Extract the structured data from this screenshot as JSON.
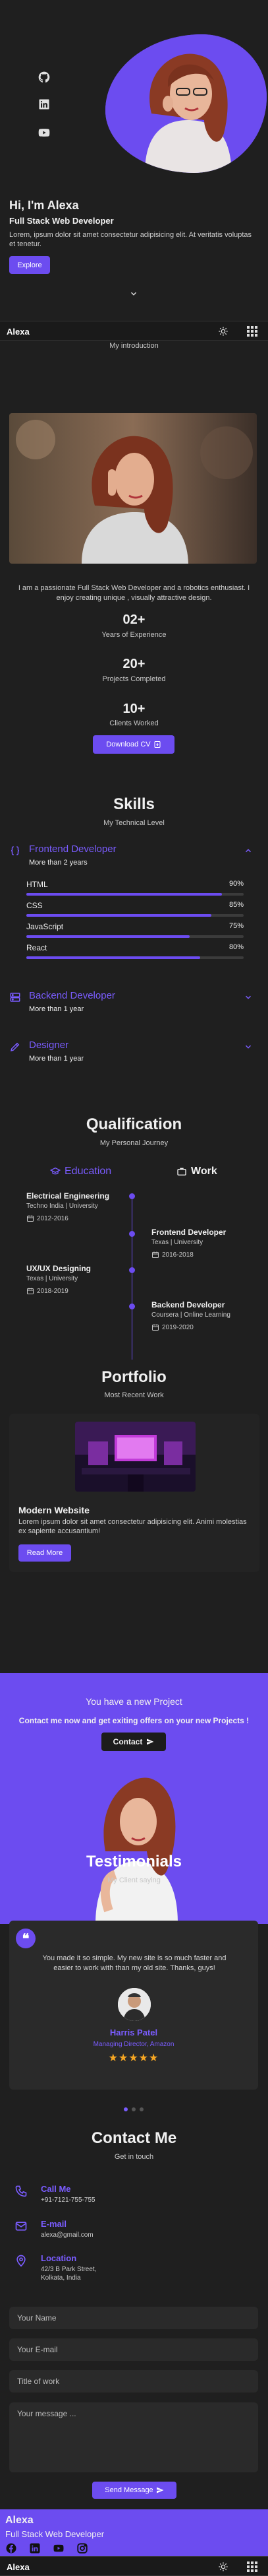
{
  "hero": {
    "title": "Hi, I'm Alexa",
    "subtitle": "Full Stack Web Developer",
    "description": "Lorem, ipsum dolor sit amet consectetur adipisicing elit. At veritatis voluptas et tenetur.",
    "button": "Explore",
    "social_icons": [
      "github-icon",
      "linkedin-icon",
      "youtube-icon"
    ]
  },
  "header": {
    "logo": "Alexa"
  },
  "about": {
    "section_subtitle": "My introduction",
    "description": "I am a passionate Full Stack Web Developer and a robotics enthusiast. I enjoy creating unique , visually attractive design.",
    "stats": [
      {
        "num": "02+",
        "label": "Years of Experience"
      },
      {
        "num": "20+",
        "label": "Projects Completed"
      },
      {
        "num": "10+",
        "label": "Clients Worked"
      }
    ],
    "download": "Download CV"
  },
  "skills": {
    "title": "Skills",
    "subtitle": "My Technical Level",
    "groups": [
      {
        "title": "Frontend Developer",
        "sub": "More than 2 years",
        "items": [
          {
            "name": "HTML",
            "pct": "90%",
            "value": 0.9
          },
          {
            "name": "CSS",
            "pct": "85%",
            "value": 0.85
          },
          {
            "name": "JavaScript",
            "pct": "75%",
            "value": 0.75
          },
          {
            "name": "React",
            "pct": "80%",
            "value": 0.8
          }
        ]
      },
      {
        "title": "Backend Developer",
        "sub": "More than 1 year"
      },
      {
        "title": "Designer",
        "sub": "More than 1 year"
      }
    ]
  },
  "qualification": {
    "title": "Qualification",
    "subtitle": "My Personal Journey",
    "tabs": [
      "Education",
      "Work"
    ],
    "items": [
      {
        "title": "Electrical Engineering",
        "sub": "Techno India | University",
        "date": "2012-2016"
      },
      {
        "title": "Frontend Developer",
        "sub": "Texas | University",
        "date": "2016-2018"
      },
      {
        "title": "UX/UX Designing",
        "sub": "Texas | University",
        "date": "2018-2019"
      },
      {
        "title": "Backend Developer",
        "sub": "Coursera | Online Learning",
        "date": "2019-2020"
      }
    ]
  },
  "portfolio": {
    "title": "Portfolio",
    "subtitle": "Most Recent Work",
    "card_title": "Modern Website",
    "card_desc": "Lorem ipsum dolor sit amet consectetur adipisicing elit. Animi molestias ex sapiente accusantium!",
    "button": "Read More"
  },
  "project": {
    "title": "You have a new Project",
    "desc": "Contact me now and get exiting offers on your new Projects !",
    "button": "Contact"
  },
  "testimonials": {
    "title": "Testimonials",
    "subtitle": "My Client saying",
    "quote": "You made it so simple. My new site is so much faster and easier to work with than my old site. Thanks, guys!",
    "name": "Harris Patel",
    "role": "Managing Director, Amazon",
    "stars": 5
  },
  "contact": {
    "title": "Contact Me",
    "subtitle": "Get in touch",
    "items": [
      {
        "title": "Call Me",
        "sub": "+91-7121-755-755",
        "icon": "phone-icon"
      },
      {
        "title": "E-mail",
        "sub": "alexa@gmail.com",
        "icon": "mail-icon"
      },
      {
        "title": "Location",
        "sub": "42/3 B Park Street, Kolkata, India",
        "icon": "location-icon"
      }
    ],
    "placeholders": {
      "name": "Your Name",
      "email": "Your E-mail",
      "work": "Title of work",
      "message": "Your message ..."
    },
    "send": "Send Message"
  },
  "footer": {
    "name": "Alexa",
    "role": "Full Stack Web Developer"
  },
  "colors": {
    "accent": "#6c4cf0",
    "background": "#1f1f1f",
    "card": "#2a2a2a"
  }
}
